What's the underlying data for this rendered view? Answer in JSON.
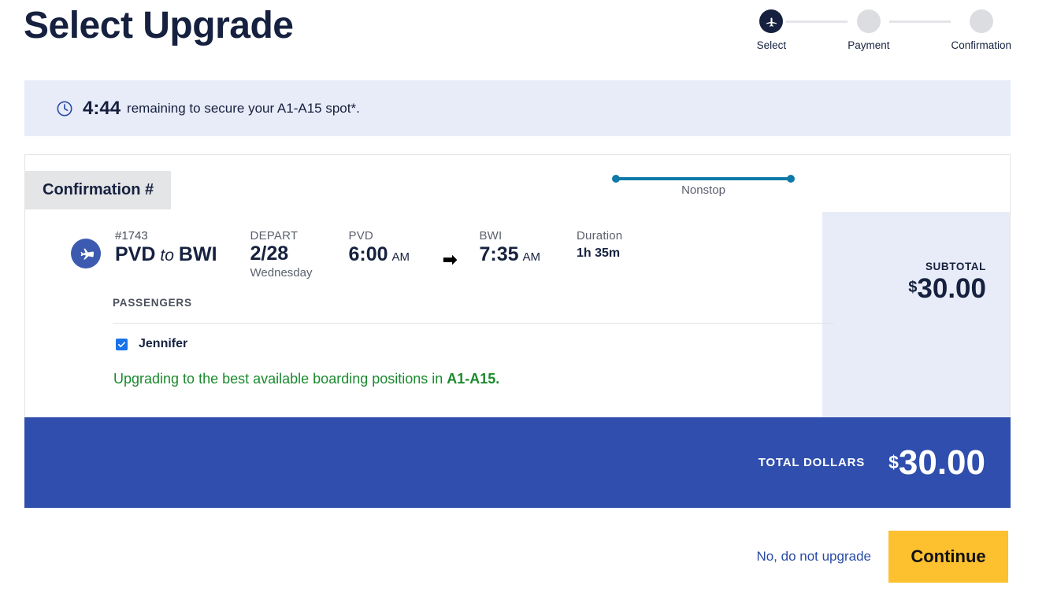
{
  "page": {
    "title": "Select Upgrade"
  },
  "stepper": {
    "steps": [
      {
        "label": "Select",
        "state": "active",
        "icon": "airplane-icon"
      },
      {
        "label": "Payment",
        "state": "inactive",
        "icon": ""
      },
      {
        "label": "Confirmation",
        "state": "inactive",
        "icon": ""
      }
    ]
  },
  "timer": {
    "icon": "clock-icon",
    "value": "4:44",
    "text": "remaining to secure your A1-A15 spot*."
  },
  "card": {
    "tab_label": "Confirmation #",
    "flight": {
      "badge_icon": "airplane-icon",
      "flight_number": "#1743",
      "origin": "PVD",
      "connector": "to",
      "destination": "BWI",
      "depart_label": "DEPART",
      "depart_date": "2/28",
      "depart_day": "Wednesday",
      "origin_code": "PVD",
      "depart_time": "6:00",
      "depart_meridiem": "AM",
      "arrow_icon": "arrow-right-icon",
      "destination_code": "BWI",
      "arrive_time": "7:35",
      "arrive_meridiem": "AM",
      "duration_label": "Duration",
      "duration_value": "1h 35m",
      "stops_label": "Nonstop"
    },
    "passengers_label": "PASSENGERS",
    "passengers": [
      {
        "name": "Jennifer",
        "checked": true
      }
    ],
    "upgrade_note_prefix": "Upgrading to the best available boarding positions in ",
    "upgrade_note_emphasis": "A1-A15.",
    "subtotal_label": "SUBTOTAL",
    "subtotal_currency": "$",
    "subtotal_value": "30.00"
  },
  "total": {
    "label": "TOTAL DOLLARS",
    "currency": "$",
    "value": "30.00"
  },
  "footer": {
    "decline_label": "No, do not upgrade",
    "continue_label": "Continue"
  },
  "colors": {
    "navy": "#16213f",
    "banner_bg": "#e8ecf8",
    "total_bar": "#2f4ead",
    "accent_yellow": "#fdc02f",
    "link_blue": "#2b4ba8",
    "green": "#1a8a2e",
    "line_teal": "#0f79a8",
    "badge_blue": "#3c5bb0",
    "checkbox_blue": "#1a73e8"
  }
}
